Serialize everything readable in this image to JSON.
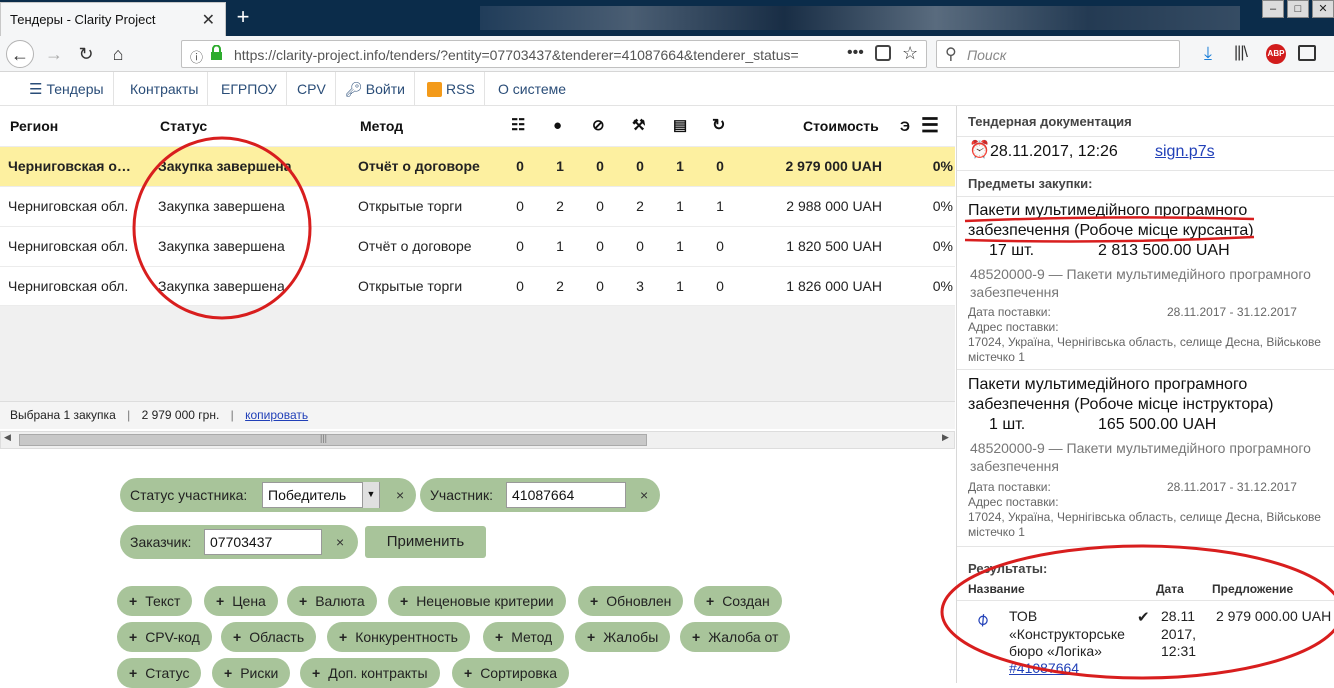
{
  "browser": {
    "tab_title": "Тендеры - Clarity Project",
    "url": "https://clarity-project.info/tenders/?entity=07703437&tenderer=41087664&tenderer_status=",
    "search_placeholder": "Поиск",
    "addon_label": "ABP"
  },
  "menu": {
    "items": [
      "Тендеры",
      "Контракты",
      "ЕГРПОУ",
      "CPV",
      "Войти",
      "RSS",
      "О системе"
    ]
  },
  "table": {
    "headers": {
      "region": "Регион",
      "status": "Статус",
      "method": "Метод",
      "cost": "Стоимость",
      "extra": "Э"
    },
    "rows": [
      {
        "region": "Черниговская о…",
        "status": "Закупка завершена",
        "method": "Отчёт о договоре",
        "n1": "0",
        "n2": "1",
        "n3": "0",
        "n4": "0",
        "n5": "1",
        "n6": "0",
        "cost": "2 979 000 UAH",
        "pct": "0%"
      },
      {
        "region": "Черниговская обл.",
        "status": "Закупка завершена",
        "method": "Открытые торги",
        "n1": "0",
        "n2": "2",
        "n3": "0",
        "n4": "2",
        "n5": "1",
        "n6": "1",
        "cost": "2 988 000 UAH",
        "pct": "0%"
      },
      {
        "region": "Черниговская обл.",
        "status": "Закупка завершена",
        "method": "Отчёт о договоре",
        "n1": "0",
        "n2": "1",
        "n3": "0",
        "n4": "0",
        "n5": "1",
        "n6": "0",
        "cost": "1 820 500 UAH",
        "pct": "0%"
      },
      {
        "region": "Черниговская обл.",
        "status": "Закупка завершена",
        "method": "Открытые торги",
        "n1": "0",
        "n2": "2",
        "n3": "0",
        "n4": "3",
        "n5": "1",
        "n6": "0",
        "cost": "1 826 000 UAH",
        "pct": "0%"
      }
    ],
    "selected_row": 0
  },
  "status_bar": {
    "selected": "Выбрана 1 закупка",
    "sum": "2 979 000 грн.",
    "copy_link": "копировать"
  },
  "filters": {
    "participant_status_label": "Статус участника:",
    "participant_status_value": "Победитель",
    "participant_label": "Участник:",
    "participant_value": "41087664",
    "customer_label": "Заказчик:",
    "customer_value": "07703437",
    "apply_label": "Применить",
    "clear_mark": "×",
    "tags": [
      "Текст",
      "Цена",
      "Валюта",
      "Неценовые критерии",
      "Обновлен",
      "Создан",
      "CPV-код",
      "Область",
      "Конкурентность",
      "Метод",
      "Жалобы",
      "Жалоба от",
      "Статус",
      "Риски",
      "Доп. контракты",
      "Сортировка"
    ]
  },
  "panel": {
    "docs_title": "Тендерная документация",
    "doc_date": "28.11.2017, 12:26",
    "doc_link": "sign.p7s",
    "items_title": "Предметы закупки:",
    "items": [
      {
        "name_line1": "Пакети мультимедійного програмного",
        "name_line2": "забезпечення (Робоче місце курсанта)",
        "qty": "17 шт.",
        "price": "2 813 500.00 UAH",
        "cpv_line1": "48520000-9 — Пакети мультимедійного програмного",
        "cpv_line2": "забезпечення",
        "delivery_date_label": "Дата поставки:",
        "delivery_date": "28.11.2017 - 31.12.2017",
        "address_label": "Адрес поставки:",
        "address_line1": "17024, Україна, Чернігівська область, селище Десна, Військове",
        "address_line2": "містечко 1"
      },
      {
        "name_line1": "Пакети мультимедійного програмного",
        "name_line2": "забезпечення (Робоче місце інструктора)",
        "qty": "1 шт.",
        "price": "165 500.00 UAH",
        "cpv_line1": "48520000-9 — Пакети мультимедійного програмного",
        "cpv_line2": "забезпечення",
        "delivery_date_label": "Дата поставки:",
        "delivery_date": "28.11.2017 - 31.12.2017",
        "address_label": "Адрес поставки:",
        "address_line1": "17024, Україна, Чернігівська область, селище Десна, Військове",
        "address_line2": "містечко 1"
      }
    ],
    "results_title": "Результаты:",
    "results_headers": {
      "name": "Название",
      "date": "Дата",
      "offer": "Предложение"
    },
    "result": {
      "name_line1": "ТОВ",
      "name_line2": "«Конструкторське",
      "name_line3": "бюро «Логіка»",
      "code": "#41087664",
      "date_line1": "28.11",
      "date_line2": "2017,",
      "date_line3": "12:31",
      "offer": "2 979 000.00 UAH"
    }
  },
  "colors": {
    "selected_row": "#fdf0a0",
    "filter_pill": "#a8c49a",
    "annotation": "#d81e1e",
    "link": "#2140b8"
  }
}
